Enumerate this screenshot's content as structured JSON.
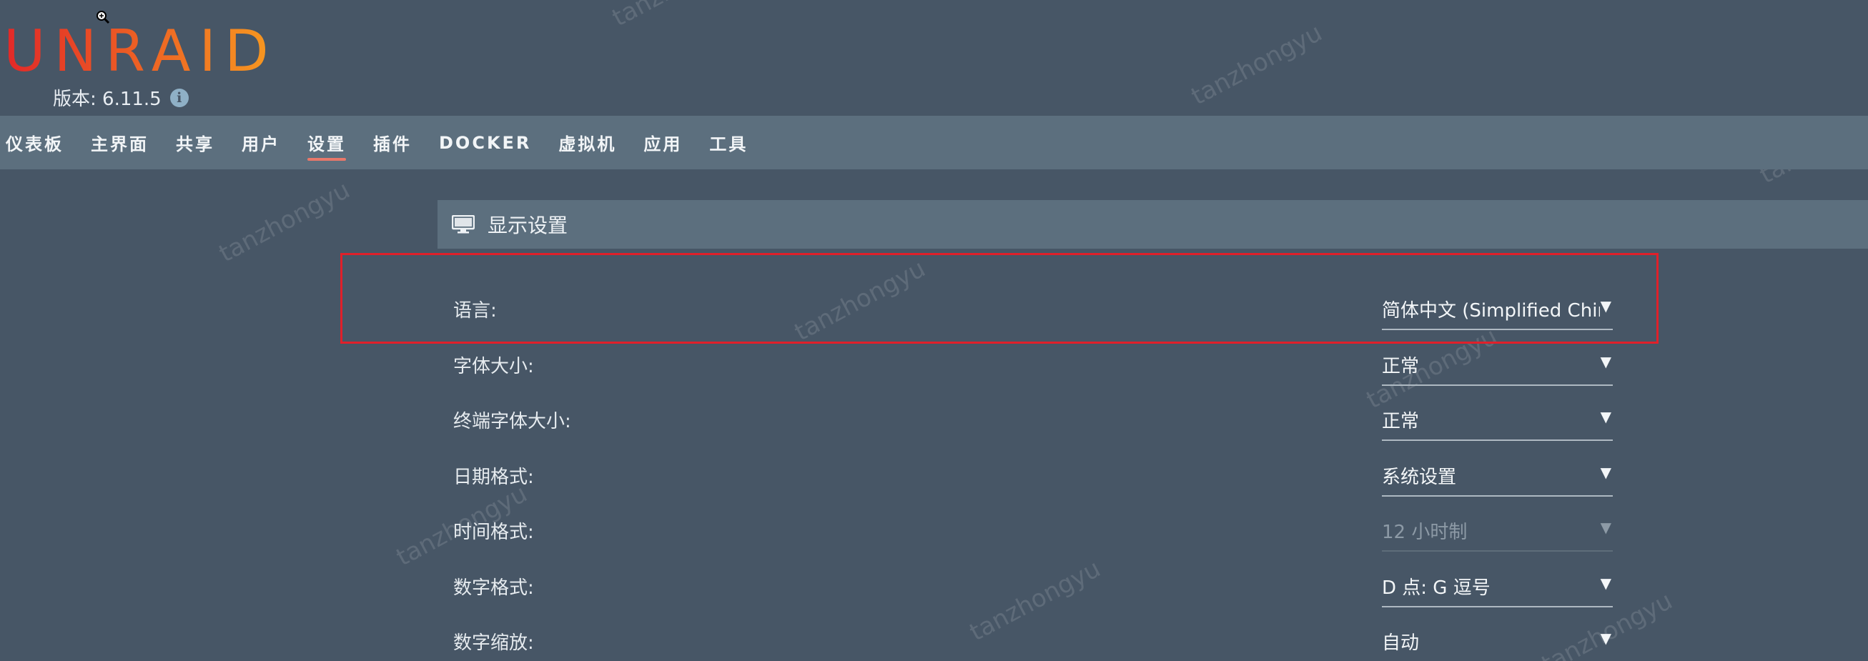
{
  "header": {
    "logo": "UNRAID",
    "version": "版本: 6.11.5",
    "info_icon": "info-icon"
  },
  "nav": {
    "items": [
      {
        "label": "仪表板"
      },
      {
        "label": "主界面"
      },
      {
        "label": "共享"
      },
      {
        "label": "用户"
      },
      {
        "label": "设置",
        "active": true
      },
      {
        "label": "插件"
      },
      {
        "label": "DOCKER"
      },
      {
        "label": "虚拟机"
      },
      {
        "label": "应用"
      },
      {
        "label": "工具"
      }
    ]
  },
  "section": {
    "title": "显示设置",
    "icon": "monitor-icon"
  },
  "settings": [
    {
      "label": "语言:",
      "value": "简体中文 (Simplified Chinese)",
      "disabled": false
    },
    {
      "label": "字体大小:",
      "value": "正常",
      "disabled": false
    },
    {
      "label": "终端字体大小:",
      "value": "正常",
      "disabled": false
    },
    {
      "label": "日期格式:",
      "value": "系统设置",
      "disabled": false
    },
    {
      "label": "时间格式:",
      "value": "12 小时制",
      "disabled": true
    },
    {
      "label": "数字格式:",
      "value": "D 点:  G 逗号",
      "disabled": false
    },
    {
      "label": "数字缩放:",
      "value": "自动",
      "disabled": false
    }
  ],
  "watermark": "tanzhongyu",
  "colors": {
    "background": "#475666",
    "bar": "#5c6f7e",
    "highlight": "#e0202a",
    "logo_start": "#e22828",
    "logo_end": "#f79a20",
    "nav_active_underline": "#e8786a"
  }
}
